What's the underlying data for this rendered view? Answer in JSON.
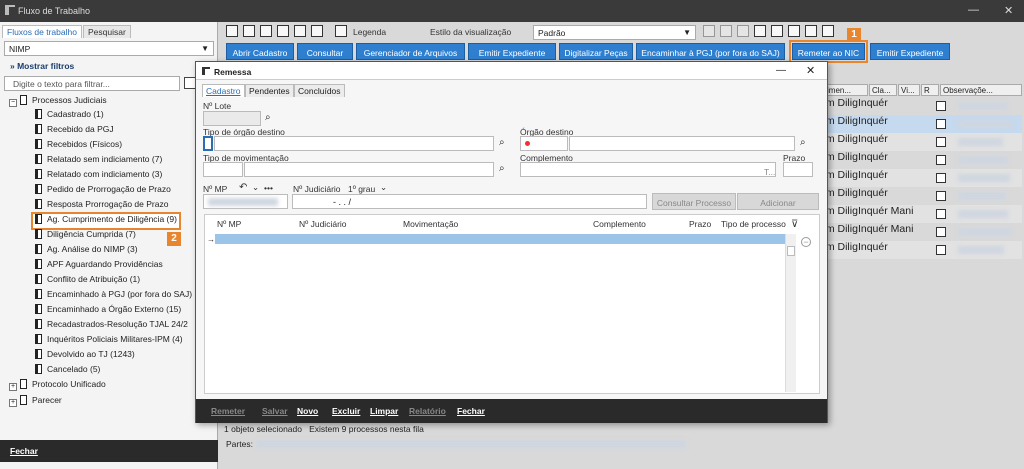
{
  "window": {
    "title": "Fluxo de Trabalho",
    "minimize": "—",
    "close": "✕"
  },
  "left_panel": {
    "tabs": [
      "Fluxos de trabalho",
      "Pesquisar"
    ],
    "flow_select": "NIMP",
    "show_filters": "Mostrar filtros",
    "filter_placeholder": "Digite o texto para filtrar...",
    "tree": {
      "root": "Processos Judiciais",
      "items": [
        "Cadastrado (1)",
        "Recebido da PGJ",
        "Recebidos (Físicos)",
        "Relatado sem indiciamento (7)",
        "Relatado com indiciamento (3)",
        "Pedido de Prorrogação de Prazo",
        "Resposta Prorrogação de Prazo",
        "Ag. Cumprimento de Diligência (9)",
        "Diligência Cumprida (7)",
        "Ag. Análise do NIMP (3)",
        "APF Aguardando Providências",
        "Conflito de Atribuição (1)",
        "Encaminhado à PGJ (por fora do SAJ)",
        "Encaminhado a Órgão Externo (15)",
        "Recadastrados-Resolução TJAL 24/2",
        "Inquéritos Policiais Militares-IPM (4)",
        "Devolvido ao TJ (1243)",
        "Cancelado (5)"
      ],
      "others": [
        "Protocolo Unificado",
        "Parecer"
      ]
    },
    "close_button": "Fechar"
  },
  "toolbar": {
    "legend": "Legenda",
    "view_style_label": "Estilo da visualização",
    "view_style_value": "Padrão"
  },
  "actions": [
    "Abrir Cadastro",
    "Consultar",
    "Gerenciador de Arquivos",
    "Emitir Expediente",
    "Digitalizar Peças",
    "Encaminhar à PGJ (por fora do SAJ)",
    "Remeter ao NIC",
    "Emitir Expediente"
  ],
  "badges": {
    "one": "1",
    "two": "2"
  },
  "bg_table": {
    "headers": [
      "vimen...",
      "Cla...",
      "Vi...",
      "R",
      "Observaçõe..."
    ],
    "rows": [
      {
        "c1": "om Dilig",
        "c2": "Inquér",
        "c3": ""
      },
      {
        "c1": "om Dilig",
        "c2": "Inquér",
        "c3": ""
      },
      {
        "c1": "om Dilig",
        "c2": "Inquér",
        "c3": ""
      },
      {
        "c1": "om Dilig",
        "c2": "Inquér",
        "c3": ""
      },
      {
        "c1": "om Dilig",
        "c2": "Inquér",
        "c3": ""
      },
      {
        "c1": "om Dilig",
        "c2": "Inquér",
        "c3": ""
      },
      {
        "c1": "om Dilig",
        "c2": "Inquér",
        "c3": "Mani"
      },
      {
        "c1": "om Dilig",
        "c2": "Inquér",
        "c3": "Mani"
      },
      {
        "c1": "om Dilig",
        "c2": "Inquér",
        "c3": ""
      }
    ]
  },
  "status": {
    "selected": "1 objeto selecionado",
    "count": "Existem 9 processos nesta fila",
    "partes_label": "Partes:"
  },
  "dialog": {
    "title": "Remessa",
    "tabs": [
      "Cadastro",
      "Pendentes",
      "Concluídos"
    ],
    "labels": {
      "lote": "Nº Lote",
      "tipo_orgao": "Tipo de órgão destino",
      "orgao": "Órgão destino",
      "tipo_mov": "Tipo de movimentação",
      "complemento": "Complemento",
      "prazo": "Prazo",
      "mp": "Nº MP",
      "judicial": "Nº Judiciário",
      "grau": "1º grau",
      "judicial_value": "-  .    .    /",
      "more": "•••",
      "prazo_suffix": "T..."
    },
    "buttons": {
      "consultar": "Consultar Processo",
      "adicionar": "Adicionar"
    },
    "table_headers": [
      "Nº MP",
      "Nº Judiciário",
      "Movimentação",
      "Complemento",
      "Prazo",
      "Tipo de processo"
    ],
    "footer": [
      "Remeter",
      "Salvar",
      "Novo",
      "Excluir",
      "Limpar",
      "Relatório",
      "Fechar"
    ]
  }
}
